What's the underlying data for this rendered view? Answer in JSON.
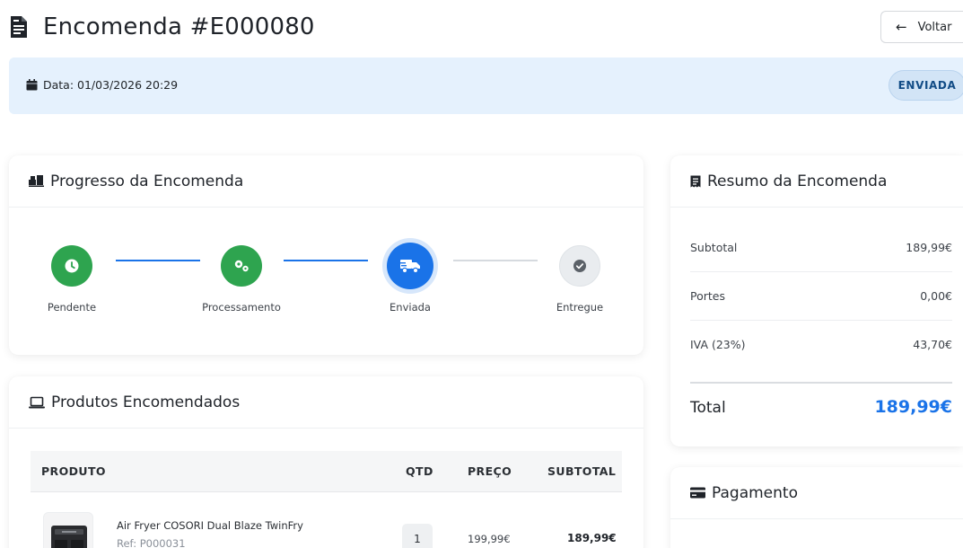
{
  "header": {
    "title": "Encomenda #E000080",
    "back_label": "Voltar"
  },
  "info": {
    "date_text": "Data: 01/03/2026 20:29",
    "status_badge": "ENVIADA"
  },
  "progress": {
    "title": "Progresso da Encomenda",
    "steps": [
      {
        "label": "Pendente",
        "state": "done",
        "icon": "clock-icon"
      },
      {
        "label": "Processamento",
        "state": "done",
        "icon": "gears-icon"
      },
      {
        "label": "Enviada",
        "state": "current",
        "icon": "truck-icon"
      },
      {
        "label": "Entregue",
        "state": "todo",
        "icon": "check-icon"
      }
    ]
  },
  "products": {
    "title": "Produtos Encomendados",
    "columns": {
      "product": "PRODUTO",
      "qty": "QTD",
      "price": "PREÇO",
      "subtotal": "SUBTOTAL"
    },
    "rows": [
      {
        "name": "Air Fryer COSORI Dual Blaze TwinFry",
        "ref": "Ref: P000031",
        "qty": "1",
        "price": "199,99€",
        "subtotal": "189,99€"
      }
    ]
  },
  "summary": {
    "title": "Resumo da Encomenda",
    "rows": [
      {
        "label": "Subtotal",
        "value": "189,99€"
      },
      {
        "label": "Portes",
        "value": "0,00€"
      },
      {
        "label": "IVA (23%)",
        "value": "43,70€"
      }
    ],
    "total_label": "Total",
    "total_value": "189,99€"
  },
  "payment": {
    "title": "Pagamento"
  },
  "colors": {
    "accent": "#1a73e8",
    "success": "#2ea44f",
    "info_bar": "#e5f1fd",
    "badge_text": "#124c86"
  }
}
